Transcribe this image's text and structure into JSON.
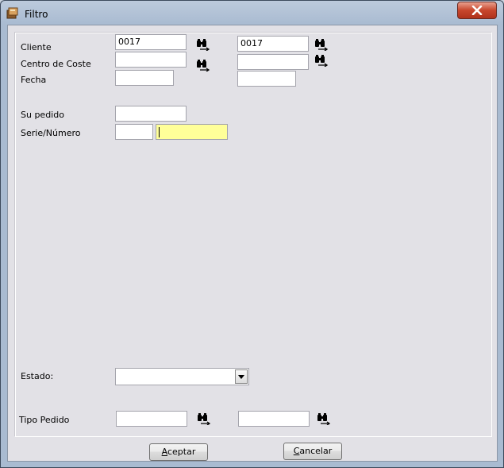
{
  "window": {
    "title": "Filtro",
    "background_title": "",
    "colors": {
      "focus_field": "#ffff99",
      "close_button": "#c7462c"
    }
  },
  "form": {
    "cliente": {
      "label": "Cliente",
      "from": "0017",
      "to": "0017"
    },
    "centro_coste": {
      "label": "Centro de Coste",
      "from": "",
      "to": ""
    },
    "fecha": {
      "label": "Fecha",
      "from": "",
      "to": ""
    },
    "su_pedido": {
      "label": "Su pedido",
      "value": ""
    },
    "serie_numero": {
      "label": "Serie/Número",
      "serie": "",
      "numero": ""
    },
    "estado": {
      "label": "Estado:",
      "selected": ""
    },
    "tipo_pedido": {
      "label": "Tipo Pedido",
      "from": "",
      "to": ""
    }
  },
  "buttons": {
    "aceptar": {
      "mnemonic": "A",
      "rest": "ceptar"
    },
    "cancelar": {
      "mnemonic": "C",
      "rest": "ancelar"
    }
  },
  "icons": {
    "lookup": "binoculars-icon",
    "close": "close-icon",
    "app": "app-icon",
    "dropdown": "chevron-down-icon"
  }
}
